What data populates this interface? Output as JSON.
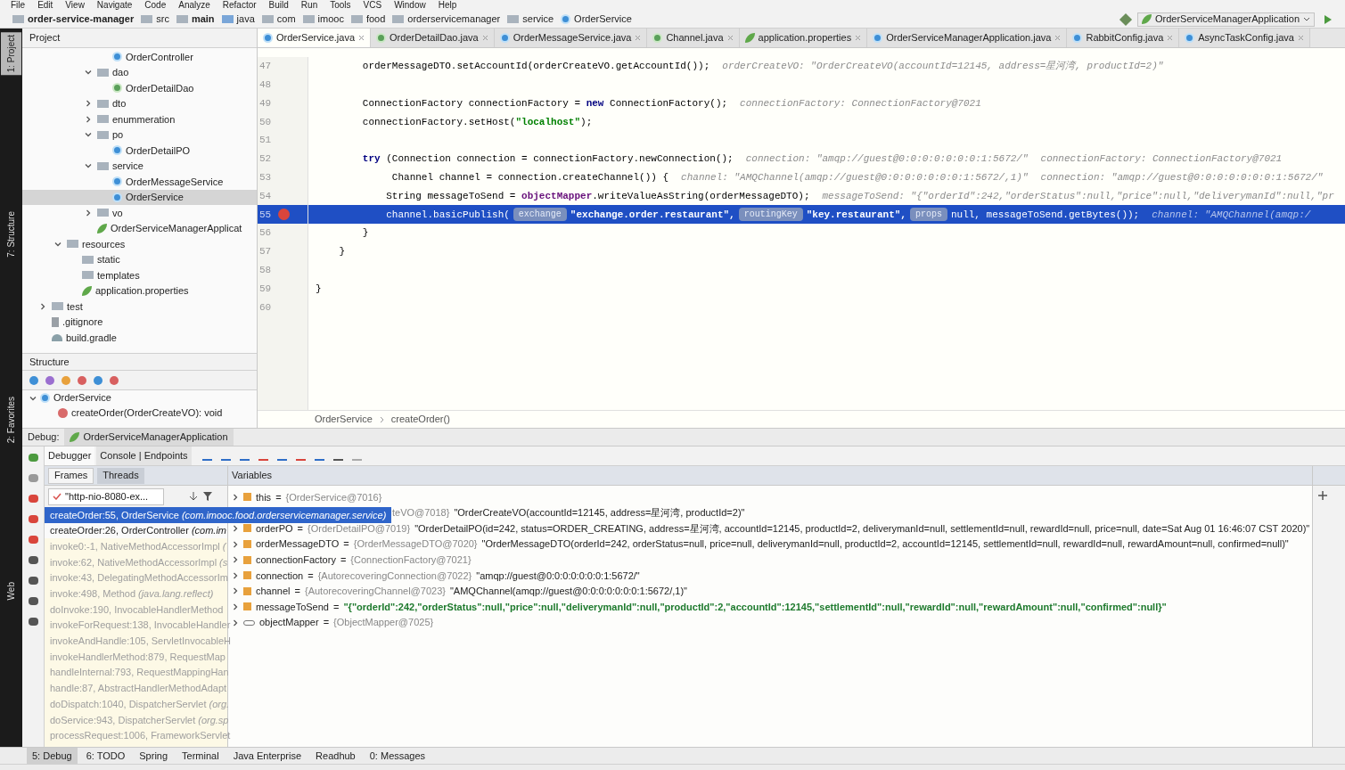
{
  "menu": [
    "File",
    "Edit",
    "View",
    "Navigate",
    "Code",
    "Analyze",
    "Refactor",
    "Build",
    "Run",
    "Tools",
    "VCS",
    "Window",
    "Help"
  ],
  "nav_bar": {
    "crumbs": [
      {
        "label": "order-service-manager",
        "kind": "module"
      },
      {
        "label": "src",
        "kind": "folder"
      },
      {
        "label": "main",
        "kind": "module"
      },
      {
        "label": "java",
        "kind": "source"
      },
      {
        "label": "com",
        "kind": "folder"
      },
      {
        "label": "imooc",
        "kind": "folder"
      },
      {
        "label": "food",
        "kind": "folder"
      },
      {
        "label": "orderservicemanager",
        "kind": "folder"
      },
      {
        "label": "service",
        "kind": "folder"
      },
      {
        "label": "OrderService",
        "kind": "class"
      }
    ],
    "run_config": "OrderServiceManagerApplication"
  },
  "side_stripe": [
    "1: Project",
    "7: Structure",
    "2: Favorites",
    "Web"
  ],
  "project": {
    "title": "Project",
    "tree": [
      {
        "children": [
          {
            "children": [
              {
                "children": [
                  {
                    "children": [
                      {
                        "label": "OrderController",
                        "kind": "class",
                        "selected": false
                      }
                    ]
                  },
                  {
                    "label": "dao",
                    "kind": "folder",
                    "expanded": true,
                    "selected": false,
                    "children": [
                      {
                        "label": "OrderDetailDao",
                        "kind": "interface",
                        "selected": false
                      }
                    ]
                  },
                  {
                    "label": "dto",
                    "kind": "folder",
                    "expanded": false,
                    "selected": false
                  },
                  {
                    "label": "enummeration",
                    "kind": "folder",
                    "expanded": false,
                    "selected": false
                  },
                  {
                    "label": "po",
                    "kind": "folder",
                    "expanded": true,
                    "selected": false,
                    "children": [
                      {
                        "label": "OrderDetailPO",
                        "kind": "class",
                        "selected": false
                      }
                    ]
                  },
                  {
                    "label": "service",
                    "kind": "folder",
                    "expanded": true,
                    "selected": false,
                    "children": [
                      {
                        "label": "OrderMessageService",
                        "kind": "class",
                        "selected": false
                      },
                      {
                        "label": "OrderService",
                        "kind": "class",
                        "selected": true
                      }
                    ]
                  },
                  {
                    "label": "vo",
                    "kind": "folder",
                    "expanded": false,
                    "selected": false
                  },
                  {
                    "label": "OrderServiceManagerApplicat",
                    "kind": "app",
                    "selected": false
                  }
                ]
              }
            ]
          },
          {
            "label": "resources",
            "kind": "folder",
            "expanded": true,
            "selected": false,
            "children": [
              {
                "label": "static",
                "kind": "folder",
                "selected": false
              },
              {
                "label": "templates",
                "kind": "folder",
                "selected": false
              },
              {
                "label": "application.properties",
                "kind": "app",
                "selected": false
              }
            ]
          }
        ]
      },
      {
        "label": "test",
        "kind": "folder",
        "expanded": false,
        "selected": false
      },
      {
        "label": ".gitignore",
        "kind": "file",
        "selected": false
      },
      {
        "label": "build.gradle",
        "kind": "gradle",
        "selected": false
      }
    ]
  },
  "structure": {
    "title": "Structure",
    "class": "OrderService",
    "method": "createOrder(OrderCreateVO): void"
  },
  "editor": {
    "tabs": [
      {
        "label": "OrderService.java",
        "kind": "class",
        "selected": true
      },
      {
        "label": "OrderDetailDao.java",
        "kind": "interface",
        "selected": false
      },
      {
        "label": "OrderMessageService.java",
        "kind": "class",
        "selected": false
      },
      {
        "label": "Channel.java",
        "kind": "interface",
        "selected": false
      },
      {
        "label": "application.properties",
        "kind": "app",
        "selected": false
      },
      {
        "label": "OrderServiceManagerApplication.java",
        "kind": "class",
        "selected": false
      },
      {
        "label": "RabbitConfig.java",
        "kind": "class",
        "selected": false
      },
      {
        "label": "AsyncTaskConfig.java",
        "kind": "class",
        "selected": false
      }
    ],
    "lines": [
      {
        "number": "47",
        "current": false,
        "breakpoint": false,
        "segments": [
          {
            "kind": "plain",
            "text": "        orderMessageDTO.setAccountId(orderCreateVO.getAccountId());"
          },
          {
            "kind": "hint",
            "text": "orderCreateVO: \"OrderCreateVO(accountId=12145, address=星河湾, productId=2)\""
          }
        ]
      },
      {
        "number": "48",
        "current": false,
        "breakpoint": false
      },
      {
        "number": "49",
        "current": false,
        "breakpoint": false,
        "segments": [
          {
            "kind": "plain",
            "text": "        ConnectionFactory connectionFactory = "
          },
          {
            "kind": "keyword",
            "text": "new"
          },
          {
            "kind": "plain",
            "text": " ConnectionFactory();"
          },
          {
            "kind": "hint",
            "text": "connectionFactory: ConnectionFactory@7021"
          }
        ]
      },
      {
        "number": "50",
        "current": false,
        "breakpoint": false,
        "segments": [
          {
            "kind": "plain",
            "text": "        connectionFactory.setHost("
          },
          {
            "kind": "string",
            "text": "\"localhost\""
          },
          {
            "kind": "plain",
            "text": ");"
          }
        ]
      },
      {
        "number": "51",
        "current": false,
        "breakpoint": false
      },
      {
        "number": "52",
        "current": false,
        "breakpoint": false,
        "segments": [
          {
            "kind": "keyword",
            "text": "        try"
          },
          {
            "kind": "plain",
            "text": " (Connection connection = connectionFactory.newConnection();"
          },
          {
            "kind": "hint",
            "text": "connection: \"amqp://guest@0:0:0:0:0:0:0:1:5672/\""
          },
          {
            "kind": "hint",
            "text": "connectionFactory: ConnectionFactory@7021"
          }
        ]
      },
      {
        "number": "53",
        "current": false,
        "breakpoint": false,
        "segments": [
          {
            "kind": "plain",
            "text": "             Channel channel = connection.createChannel()) {"
          },
          {
            "kind": "hint",
            "text": "channel: \"AMQChannel(amqp://guest@0:0:0:0:0:0:0:1:5672/,1)\""
          },
          {
            "kind": "hint",
            "text": "connection: \"amqp://guest@0:0:0:0:0:0:0:1:5672/\""
          }
        ]
      },
      {
        "number": "54",
        "current": false,
        "breakpoint": false,
        "segments": [
          {
            "kind": "plain",
            "text": "            String messageToSend = "
          },
          {
            "kind": "field",
            "text": "objectMapper"
          },
          {
            "kind": "plain",
            "text": ".writeValueAsString(orderMessageDTO);"
          },
          {
            "kind": "hint",
            "text": "messageToSend: \"{\"orderId\":242,\"orderStatus\":null,\"price\":null,\"deliverymanId\":null,\"pr"
          }
        ]
      },
      {
        "number": "55",
        "current": true,
        "breakpoint": true,
        "segments": [
          {
            "kind": "plain",
            "text": "            channel.basicPublish("
          },
          {
            "kind": "param",
            "text": "exchange"
          },
          {
            "kind": "string",
            "text": "\"exchange.order.restaurant\","
          },
          {
            "kind": "param",
            "text": "routingKey"
          },
          {
            "kind": "string",
            "text": "\"key.restaurant\","
          },
          {
            "kind": "param",
            "text": "props"
          },
          {
            "kind": "plain",
            "text": "null, messageToSend.getBytes());"
          },
          {
            "kind": "hint",
            "text": "channel: \"AMQChannel(amqp:/"
          }
        ]
      },
      {
        "number": "56",
        "current": false,
        "breakpoint": false,
        "segments": [
          {
            "kind": "plain",
            "text": "        }"
          }
        ]
      },
      {
        "number": "57",
        "current": false,
        "breakpoint": false,
        "segments": [
          {
            "kind": "plain",
            "text": "    }"
          }
        ]
      },
      {
        "number": "58",
        "current": false,
        "breakpoint": false
      },
      {
        "number": "59",
        "current": false,
        "breakpoint": false,
        "segments": [
          {
            "kind": "plain",
            "text": "}"
          }
        ]
      },
      {
        "number": "60",
        "current": false,
        "breakpoint": false
      }
    ],
    "breadcrumb": [
      "OrderService",
      "createOrder()"
    ]
  },
  "debug": {
    "label": "Debug:",
    "session": "OrderServiceManagerApplication",
    "tabs": [
      {
        "label": "Debugger",
        "selected": true
      },
      {
        "label": "Console | Endpoints",
        "selected": false
      }
    ],
    "frame_tabs": [
      {
        "label": "Frames",
        "selected": true
      },
      {
        "label": "Threads",
        "selected": false
      }
    ],
    "thread": "\"http-nio-8080-ex...",
    "frames": [
      {
        "method": "createOrder:55, OrderService",
        "package": "(com.imooc.food.orderservicemanager.service)",
        "selected": true,
        "library": false
      },
      {
        "method": "createOrder:26, OrderController",
        "package": "(com.im",
        "selected": false,
        "library": false
      },
      {
        "method": "invoke0:-1, NativeMethodAccessorImpl",
        "package": "(",
        "selected": false,
        "library": true
      },
      {
        "method": "invoke:62, NativeMethodAccessorImpl",
        "package": "(s",
        "selected": false,
        "library": true
      },
      {
        "method": "invoke:43, DelegatingMethodAccessorIm",
        "selected": false,
        "library": true
      },
      {
        "method": "invoke:498, Method",
        "package": "(java.lang.reflect)",
        "selected": false,
        "library": true
      },
      {
        "method": "doInvoke:190, InvocableHandlerMethod",
        "selected": false,
        "library": true
      },
      {
        "method": "invokeForRequest:138, InvocableHandler",
        "selected": false,
        "library": true
      },
      {
        "method": "invokeAndHandle:105, ServletInvocableH",
        "selected": false,
        "library": true
      },
      {
        "method": "invokeHandlerMethod:879, RequestMap",
        "selected": false,
        "library": true
      },
      {
        "method": "handleInternal:793, RequestMappingHan",
        "selected": false,
        "library": true
      },
      {
        "method": "handle:87, AbstractHandlerMethodAdapt",
        "selected": false,
        "library": true
      },
      {
        "method": "doDispatch:1040, DispatcherServlet",
        "package": "(org.",
        "selected": false,
        "library": true
      },
      {
        "method": "doService:943, DispatcherServlet",
        "package": "(org.sp",
        "selected": false,
        "library": true
      },
      {
        "method": "processRequest:1006, FrameworkServlet",
        "selected": false,
        "library": true
      }
    ],
    "variables_title": "Variables",
    "variables": [
      {
        "kind": "field",
        "name": "this",
        "op": "=",
        "type": "{OrderService@7016}"
      },
      {
        "kind": "partial",
        "type": "teVO@7018}",
        "value": "\"OrderCreateVO(accountId=12145, address=星河湾, productId=2)\""
      },
      {
        "kind": "field",
        "name": "orderPO",
        "op": "=",
        "type": "{OrderDetailPO@7019}",
        "value": "\"OrderDetailPO(id=242, status=ORDER_CREATING, address=星河湾, accountId=12145, productId=2, deliverymanId=null, settlementId=null, rewardId=null, price=null, date=Sat Aug 01 16:46:07 CST 2020)\""
      },
      {
        "kind": "field",
        "name": "orderMessageDTO",
        "op": "=",
        "type": "{OrderMessageDTO@7020}",
        "value": "\"OrderMessageDTO(orderId=242, orderStatus=null, price=null, deliverymanId=null, productId=2, accountId=12145, settlementId=null, rewardId=null, rewardAmount=null, confirmed=null)\""
      },
      {
        "kind": "field",
        "name": "connectionFactory",
        "op": "=",
        "type": "{ConnectionFactory@7021}"
      },
      {
        "kind": "field",
        "name": "connection",
        "op": "=",
        "type": "{AutorecoveringConnection@7022}",
        "value": "\"amqp://guest@0:0:0:0:0:0:0:1:5672/\""
      },
      {
        "kind": "field",
        "name": "channel",
        "op": "=",
        "type": "{AutorecoveringChannel@7023}",
        "value": "\"AMQChannel(amqp://guest@0:0:0:0:0:0:0:1:5672/,1)\""
      },
      {
        "kind": "string",
        "name": "messageToSend",
        "op": "=",
        "value": "\"{\"orderId\":242,\"orderStatus\":null,\"price\":null,\"deliverymanId\":null,\"productId\":2,\"accountId\":12145,\"settlementId\":null,\"rewardId\":null,\"rewardAmount\":null,\"confirmed\":null}\""
      },
      {
        "kind": "watch",
        "name": "objectMapper",
        "op": "=",
        "type": "{ObjectMapper@7025}"
      }
    ]
  },
  "tool_windows": [
    {
      "label": "5: Debug",
      "selected": true
    },
    {
      "label": "6: TODO",
      "selected": false
    },
    {
      "label": "Spring",
      "selected": false
    },
    {
      "label": "Terminal",
      "selected": false
    },
    {
      "label": "Java Enterprise",
      "selected": false
    },
    {
      "label": "Readhub",
      "selected": false
    },
    {
      "label": "0: Messages",
      "selected": false
    }
  ]
}
